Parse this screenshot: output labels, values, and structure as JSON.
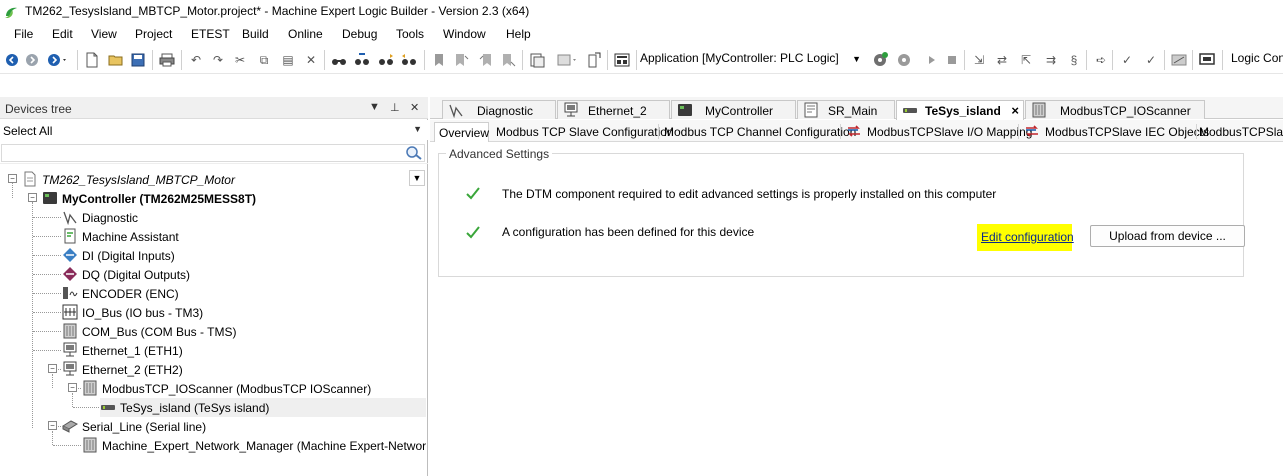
{
  "window": {
    "title": "TM262_TesysIsland_MBTCP_Motor.project* - Machine Expert Logic Builder - Version 2.3 (x64)"
  },
  "menu": [
    "File",
    "Edit",
    "View",
    "Project",
    "ETEST",
    "Build",
    "Online",
    "Debug",
    "Tools",
    "Window",
    "Help"
  ],
  "toolbar": {
    "application_selector": "Application [MyController: PLC Logic]",
    "logic_label": "Logic Con"
  },
  "devices_tree": {
    "header": "Devices tree",
    "filter_value": "Select All",
    "search_placeholder": "",
    "root": "TM262_TesysIsland_MBTCP_Motor",
    "controller": "MyController (TM262M25MESS8T)",
    "items": [
      "Diagnostic",
      "Machine Assistant",
      "DI (Digital Inputs)",
      "DQ (Digital Outputs)",
      "ENCODER (ENC)",
      "IO_Bus (IO bus - TM3)",
      "COM_Bus (COM Bus - TMS)",
      "Ethernet_1 (ETH1)",
      "Ethernet_2 (ETH2)",
      "ModbusTCP_IOScanner (ModbusTCP IOScanner)",
      "TeSys_island (TeSys island)",
      "Serial_Line (Serial line)",
      "Machine_Expert_Network_Manager (Machine Expert-Network Mana"
    ]
  },
  "doc_tabs": [
    "Diagnostic",
    "Ethernet_2",
    "MyController",
    "SR_Main",
    "TeSys_island",
    "ModbusTCP_IOScanner"
  ],
  "doc_tab_close": "×",
  "sub_tabs": [
    "Overview",
    "Modbus TCP Slave Configuration",
    "Modbus TCP Channel Configuration",
    "ModbusTCPSlave I/O Mapping",
    "ModbusTCPSlave IEC Objects",
    "ModbusTCPSlave"
  ],
  "advanced": {
    "title": "Advanced Settings",
    "msg1": "The DTM component required to edit advanced settings is properly installed on this computer",
    "msg2": "A configuration has been defined for this device",
    "edit_link": "Edit configuration",
    "upload_button": "Upload from device ..."
  },
  "colors": {
    "highlight": "#ffff00",
    "check": "#3aa63a",
    "link": "#0a2a8a"
  }
}
